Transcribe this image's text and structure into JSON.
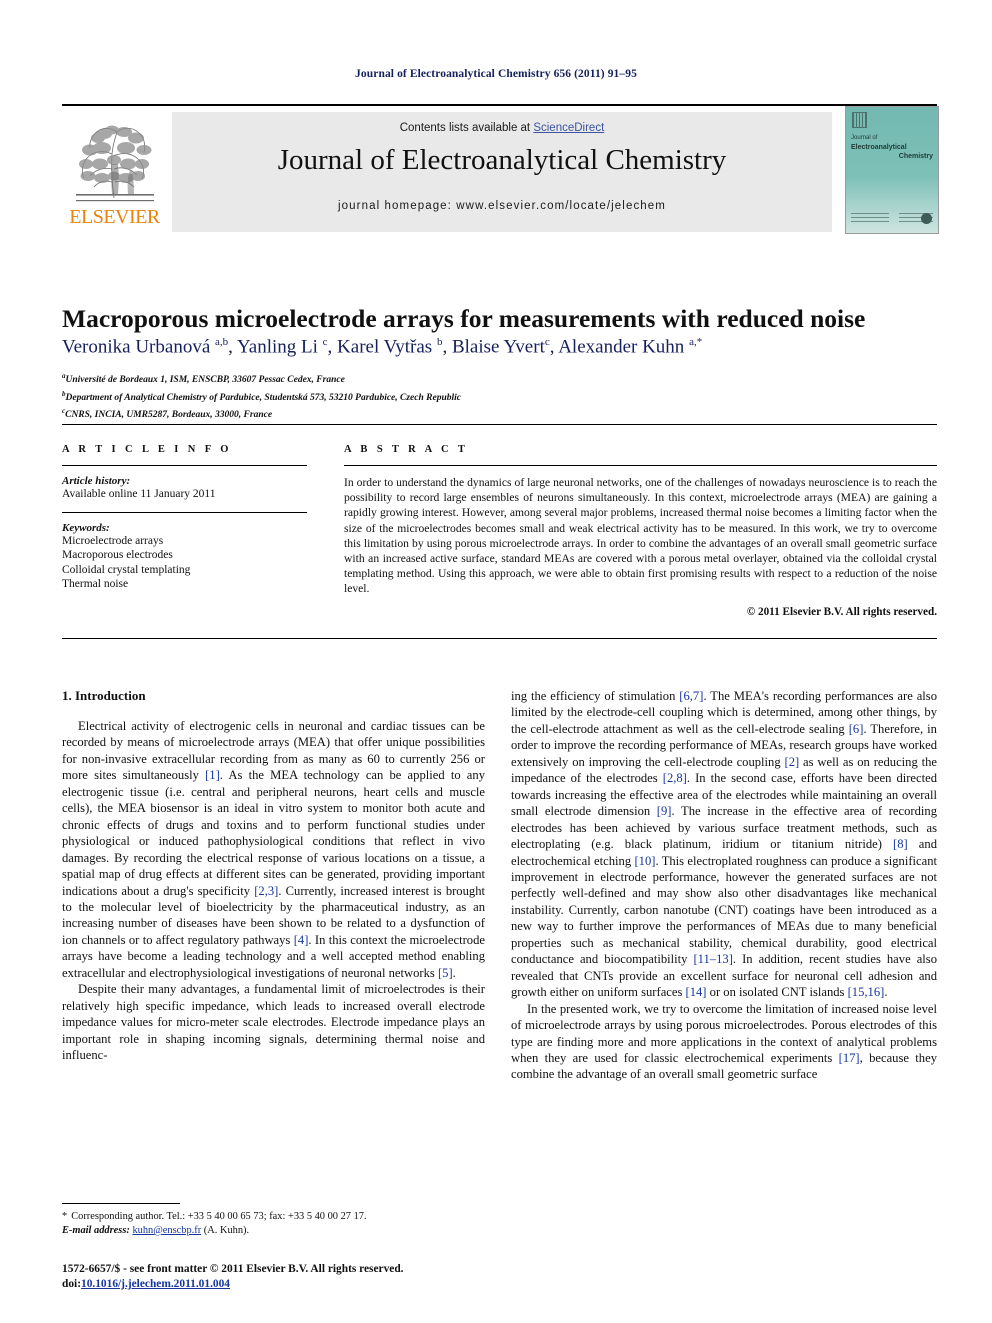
{
  "running_head": "Journal of Electroanalytical Chemistry 656 (2011) 91–95",
  "masthead": {
    "contents_prefix": "Contents lists available at ",
    "sciencedirect": "ScienceDirect",
    "journal_name": "Journal of Electroanalytical Chemistry",
    "homepage": "journal homepage: www.elsevier.com/locate/jelechem",
    "publisher": "ELSEVIER",
    "cover": {
      "line1": "Journal of",
      "line2": "Electroanalytical",
      "line3": "Chemistry"
    },
    "band_color": "#e9e9e9",
    "cover_color": "#6fb6ae",
    "elsevier_orange": "#e8830c",
    "link_color": "#3b55a4"
  },
  "article": {
    "title": "Macroporous microelectrode arrays for measurements with reduced noise",
    "authors_html": "Veronika Urbanová <sup class=\"sup\">a,b</sup>, Yanling Li <sup class=\"sup\">c</sup>, Karel Vytřas <sup class=\"sup\">b</sup>, Blaise Yvert<sup class=\"sup\">c</sup>, Alexander Kuhn <sup class=\"sup\">a,*</sup>",
    "affiliations_html": "<sup class=\"sup\">a</sup>Université de Bordeaux 1, ISM, ENSCBP, 33607 Pessac Cedex, France<br><sup class=\"sup\">b</sup>Department of Analytical Chemistry of Pardubice, Studentská 573, 53210 Pardubice, Czech Republic<br><sup class=\"sup\">c</sup>CNRS, INCIA, UMR5287, Bordeaux, 33000, France"
  },
  "info": {
    "heading": "A R T I C L E   I N F O",
    "history_label": "Article history:",
    "history_value": "Available online 11 January 2011",
    "keywords_label": "Keywords:",
    "keywords": [
      "Microelectrode arrays",
      "Macroporous electrodes",
      "Colloidal crystal templating",
      "Thermal noise"
    ]
  },
  "abstract": {
    "heading": "A B S T R A C T",
    "body": "In order to understand the dynamics of large neuronal networks, one of the challenges of nowadays neuroscience is to reach the possibility to record large ensembles of neurons simultaneously. In this context, microelectrode arrays (MEA) are gaining a rapidly growing interest. However, among several major problems, increased thermal noise becomes a limiting factor when the size of the microelectrodes becomes small and weak electrical activity has to be measured. In this work, we try to overcome this limitation by using porous microelectrode arrays. In order to combine the advantages of an overall small geometric surface with an increased active surface, standard MEAs are covered with a porous metal overlayer, obtained via the colloidal crystal templating method. Using this approach, we were able to obtain first promising results with respect to a reduction of the noise level.",
    "copyright": "© 2011 Elsevier B.V. All rights reserved."
  },
  "sections": {
    "intro_heading": "1. Introduction",
    "left_paragraphs_html": [
      "Electrical activity of electrogenic cells in neuronal and cardiac tissues can be recorded by means of microelectrode arrays (MEA) that offer unique possibilities for non-invasive extracellular recording from as many as 60 to currently 256 or more sites simultaneously <span class=\"ref\">[1]</span>. As the MEA technology can be applied to any electrogenic tissue (i.e. central and peripheral neurons, heart cells and muscle cells), the MEA biosensor is an ideal in vitro system to monitor both acute and chronic effects of drugs and toxins and to perform functional studies under physiological or induced pathophysiological conditions that reflect in vivo damages. By recording the electrical response of various locations on a tissue, a spatial map of drug effects at different sites can be generated, providing important indications about a drug's specificity <span class=\"ref\">[2,3]</span>. Currently, increased interest is brought to the molecular level of bioelectricity by the pharmaceutical industry, as an increasing number of diseases have been shown to be related to a dysfunction of ion channels or to affect regulatory pathways <span class=\"ref\">[4]</span>. In this context the microelectrode arrays have become a leading technology and a well accepted method enabling extracellular and electrophysiological investigations of neuronal networks <span class=\"ref\">[5]</span>.",
      "Despite their many advantages, a fundamental limit of microelectrodes is their relatively high specific impedance, which leads to increased overall electrode impedance values for micro-meter scale electrodes. Electrode impedance plays an important role in shaping incoming signals, determining thermal noise and influenc-"
    ],
    "right_paragraphs_html": [
      "ing the efficiency of stimulation <span class=\"ref\">[6,7]</span>. The MEA's recording performances are also limited by the electrode-cell coupling which is determined, among other things, by the cell-electrode attachment as well as the cell-electrode sealing <span class=\"ref\">[6]</span>. Therefore, in order to improve the recording performance of MEAs, research groups have worked extensively on improving the cell-electrode coupling <span class=\"ref\">[2]</span> as well as on reducing the impedance of the electrodes <span class=\"ref\">[2,8]</span>. In the second case, efforts have been directed towards increasing the effective area of the electrodes while maintaining an overall small electrode dimension <span class=\"ref\">[9]</span>. The increase in the effective area of recording electrodes has been achieved by various surface treatment methods, such as electroplating (e.g. black platinum, iridium or titanium nitride) <span class=\"ref\">[8]</span> and electrochemical etching <span class=\"ref\">[10]</span>. This electroplated roughness can produce a significant improvement in electrode performance, however the generated surfaces are not perfectly well-defined and may show also other disadvantages like mechanical instability. Currently, carbon nanotube (CNT) coatings have been introduced as a new way to further improve the performances of MEAs due to many beneficial properties such as mechanical stability, chemical durability, good electrical conductance and biocompatibility <span class=\"ref\">[11–13]</span>. In addition, recent studies have also revealed that CNTs provide an excellent surface for neuronal cell adhesion and growth either on uniform surfaces <span class=\"ref\">[14]</span> or on isolated CNT islands <span class=\"ref\">[15,16]</span>.",
      "In the presented work, we try to overcome the limitation of increased noise level of microelectrode arrays by using porous microelectrodes. Porous electrodes of this type are finding more and more applications in the context of analytical problems when they are used for classic electrochemical experiments <span class=\"ref\">[17]</span>, because they combine the advantage of an overall small geometric surface"
    ]
  },
  "footnote": {
    "star": "*",
    "corresponding": "Corresponding author. Tel.: +33 5 40 00 65 73; fax: +33 5 40 00 27 17.",
    "email_label": "E-mail address:",
    "email": "kuhn@enscbp.fr",
    "email_suffix": "(A. Kuhn)."
  },
  "footer": {
    "frontmatter": "1572-6657/$ - see front matter © 2011 Elsevier B.V. All rights reserved.",
    "doi_label": "doi:",
    "doi": "10.1016/j.jelechem.2011.01.004"
  }
}
